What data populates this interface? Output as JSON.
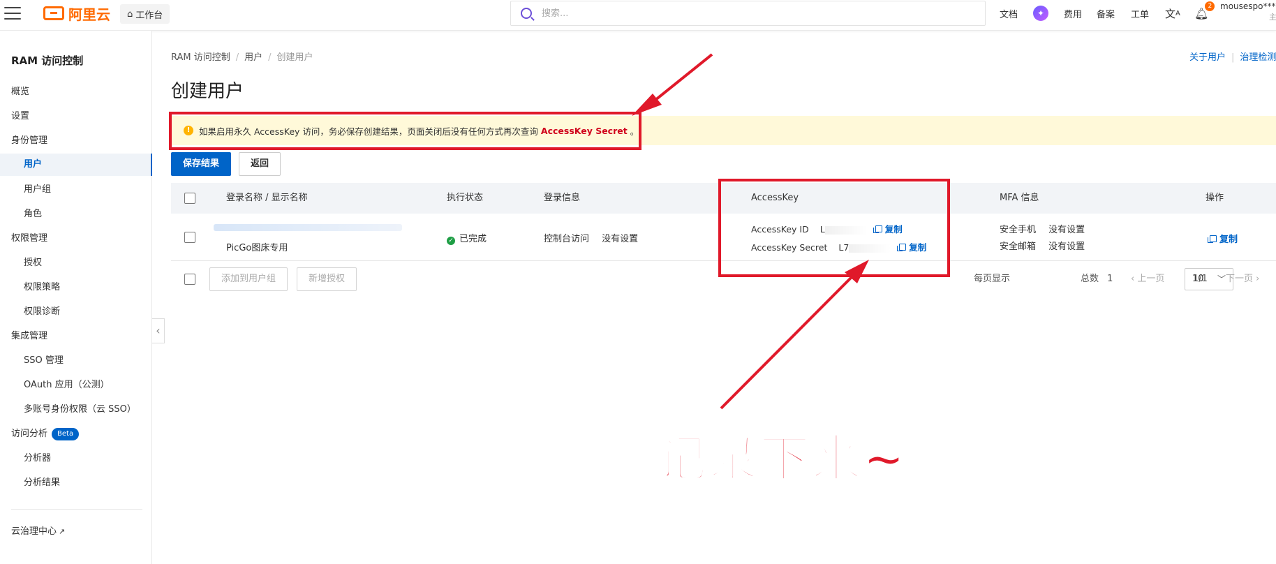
{
  "topbar": {
    "logo_text": "阿里云",
    "workbench_label": "工作台",
    "search_placeholder": "搜索...",
    "nav": [
      "文档",
      "费用",
      "备案",
      "工单"
    ],
    "notification_count": "2",
    "username": "mousespo***",
    "user_sub": "主"
  },
  "sidebar": {
    "title": "RAM 访问控制",
    "items": [
      {
        "label": "概览"
      },
      {
        "label": "设置"
      },
      {
        "label": "身份管理"
      },
      {
        "label": "用户"
      },
      {
        "label": "用户组"
      },
      {
        "label": "角色"
      },
      {
        "label": "权限管理"
      },
      {
        "label": "授权"
      },
      {
        "label": "权限策略"
      },
      {
        "label": "权限诊断"
      },
      {
        "label": "集成管理"
      },
      {
        "label": "SSO 管理"
      },
      {
        "label": "OAuth 应用（公测）"
      },
      {
        "label": "多账号身份权限（云 SSO）"
      },
      {
        "label": "访问分析"
      },
      {
        "label": "分析器"
      },
      {
        "label": "分析结果"
      }
    ],
    "beta_badge": "Beta",
    "footer_link": "云治理中心"
  },
  "breadcrumb": [
    "RAM 访问控制",
    "用户",
    "创建用户"
  ],
  "top_links": [
    "关于用户",
    "治理检测"
  ],
  "page_title": "创建用户",
  "alert": {
    "text": "如果启用永久 AccessKey 访问，务必保存创建结果，页面关闭后没有任何方式再次查询",
    "highlight": "AccessKey Secret",
    "end": "。"
  },
  "buttons": {
    "save": "保存结果",
    "back": "返回",
    "add_to_group": "添加到用户组",
    "add_grant": "新增授权"
  },
  "table": {
    "headers": [
      "登录名称 / 显示名称",
      "执行状态",
      "登录信息",
      "AccessKey",
      "MFA 信息",
      "操作"
    ],
    "row": {
      "display_name": "PicGo图床专用",
      "status": "已完成",
      "login_type": "控制台访问",
      "login_value": "没有设置",
      "ak_id_label": "AccessKey ID",
      "ak_id_prefix": "L",
      "ak_secret_label": "AccessKey Secret",
      "ak_secret_prefix": "L7",
      "copy": "复制",
      "mfa_phone_label": "安全手机",
      "mfa_phone_value": "没有设置",
      "mfa_email_label": "安全邮箱",
      "mfa_email_value": "没有设置",
      "action_copy": "复制"
    }
  },
  "pagination": {
    "per_page_label": "每页显示",
    "per_page_value": "10",
    "total_label": "总数",
    "total_value": "1",
    "prev": "上一页",
    "page": "1/1",
    "next": "下一页"
  },
  "annotation": {
    "text": "记录下来~",
    "color": "#e0192a"
  },
  "colors": {
    "brand_orange": "#ff6a00",
    "primary_blue": "#0064c8",
    "alert_bg": "#fff9d9",
    "success_green": "#1e9e45"
  }
}
